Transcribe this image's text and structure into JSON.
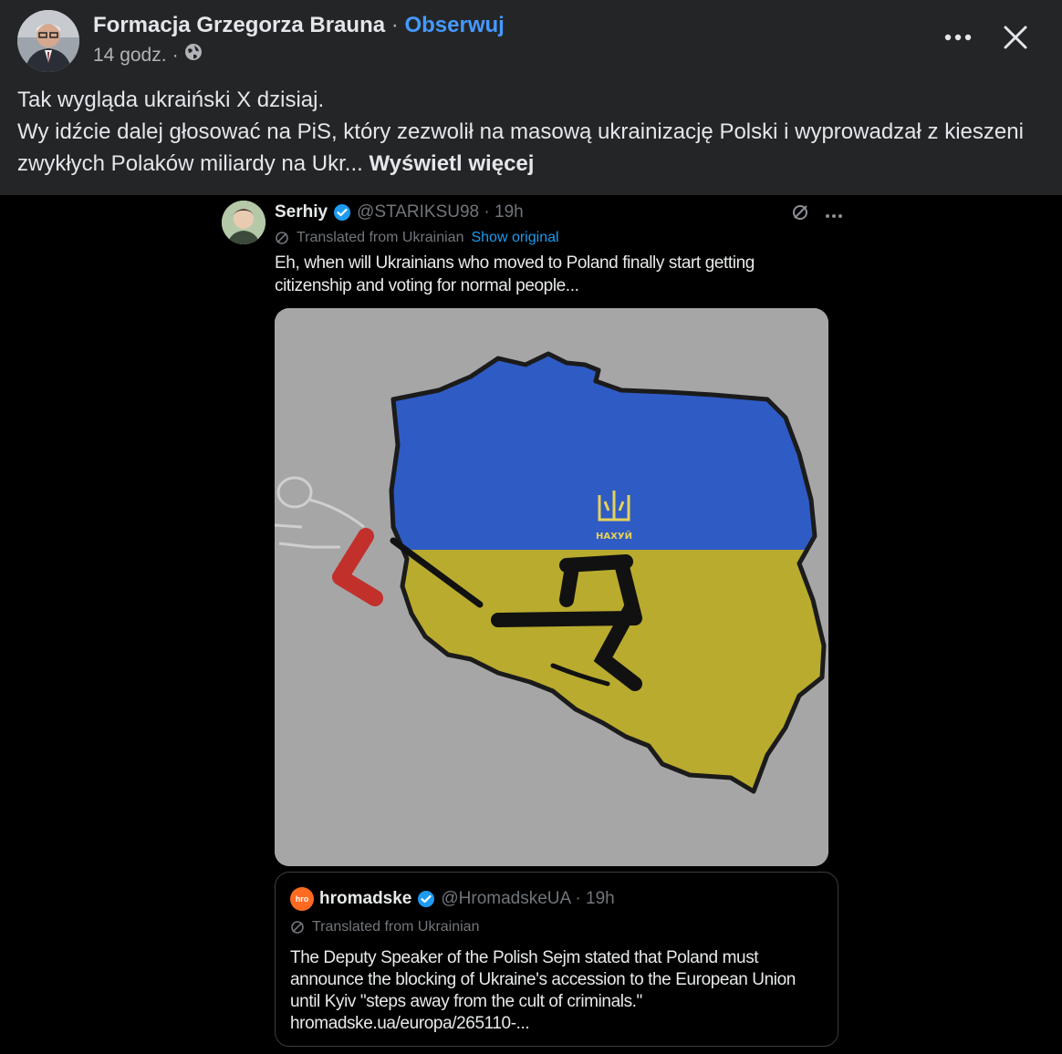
{
  "post": {
    "author": "Formacja Grzegorza Brauna",
    "separator": "·",
    "follow_label": "Obserwuj",
    "time": "14 godz.",
    "meta_separator": "·",
    "audience_icon": "globe-icon",
    "more_icon": "more-horizontal-icon",
    "close_icon": "close-icon",
    "text_line1": "Tak wygląda ukraiński X dzisiaj.",
    "text_line2": "Wy idźcie dalej głosować na PiS, który zezwolił na masową ukrainizację Polski i wyprowadzał z kieszeni zwykłych Polaków miliardy na Ukr...",
    "see_more": "Wyświetl więcej"
  },
  "tweet": {
    "name": "Serhiy",
    "handle": "@STARIKSU98 · 19h",
    "translated_label": "Translated from Ukrainian",
    "show_original": "Show original",
    "body": "Eh, when will Ukrainians who moved to Poland finally start getting citizenship and voting for normal people...",
    "image_text": "НАХУЙ",
    "colors": {
      "flag_blue": "#2f5bc4",
      "flag_yellow": "#b9ab2e",
      "image_bg": "#a6a6a6",
      "red_letter": "#c2302c"
    }
  },
  "quote": {
    "logo_text": "hro",
    "name": "hromadske",
    "handle": "@HromadskeUA · 19h",
    "translated_label": "Translated from Ukrainian",
    "body": "The Deputy Speaker of the Polish Sejm stated that Poland must announce the blocking of Ukraine's accession to the European Union until Kyiv \"steps away from the cult of criminals.\"",
    "link": "hromadske.ua/europa/265110-..."
  }
}
